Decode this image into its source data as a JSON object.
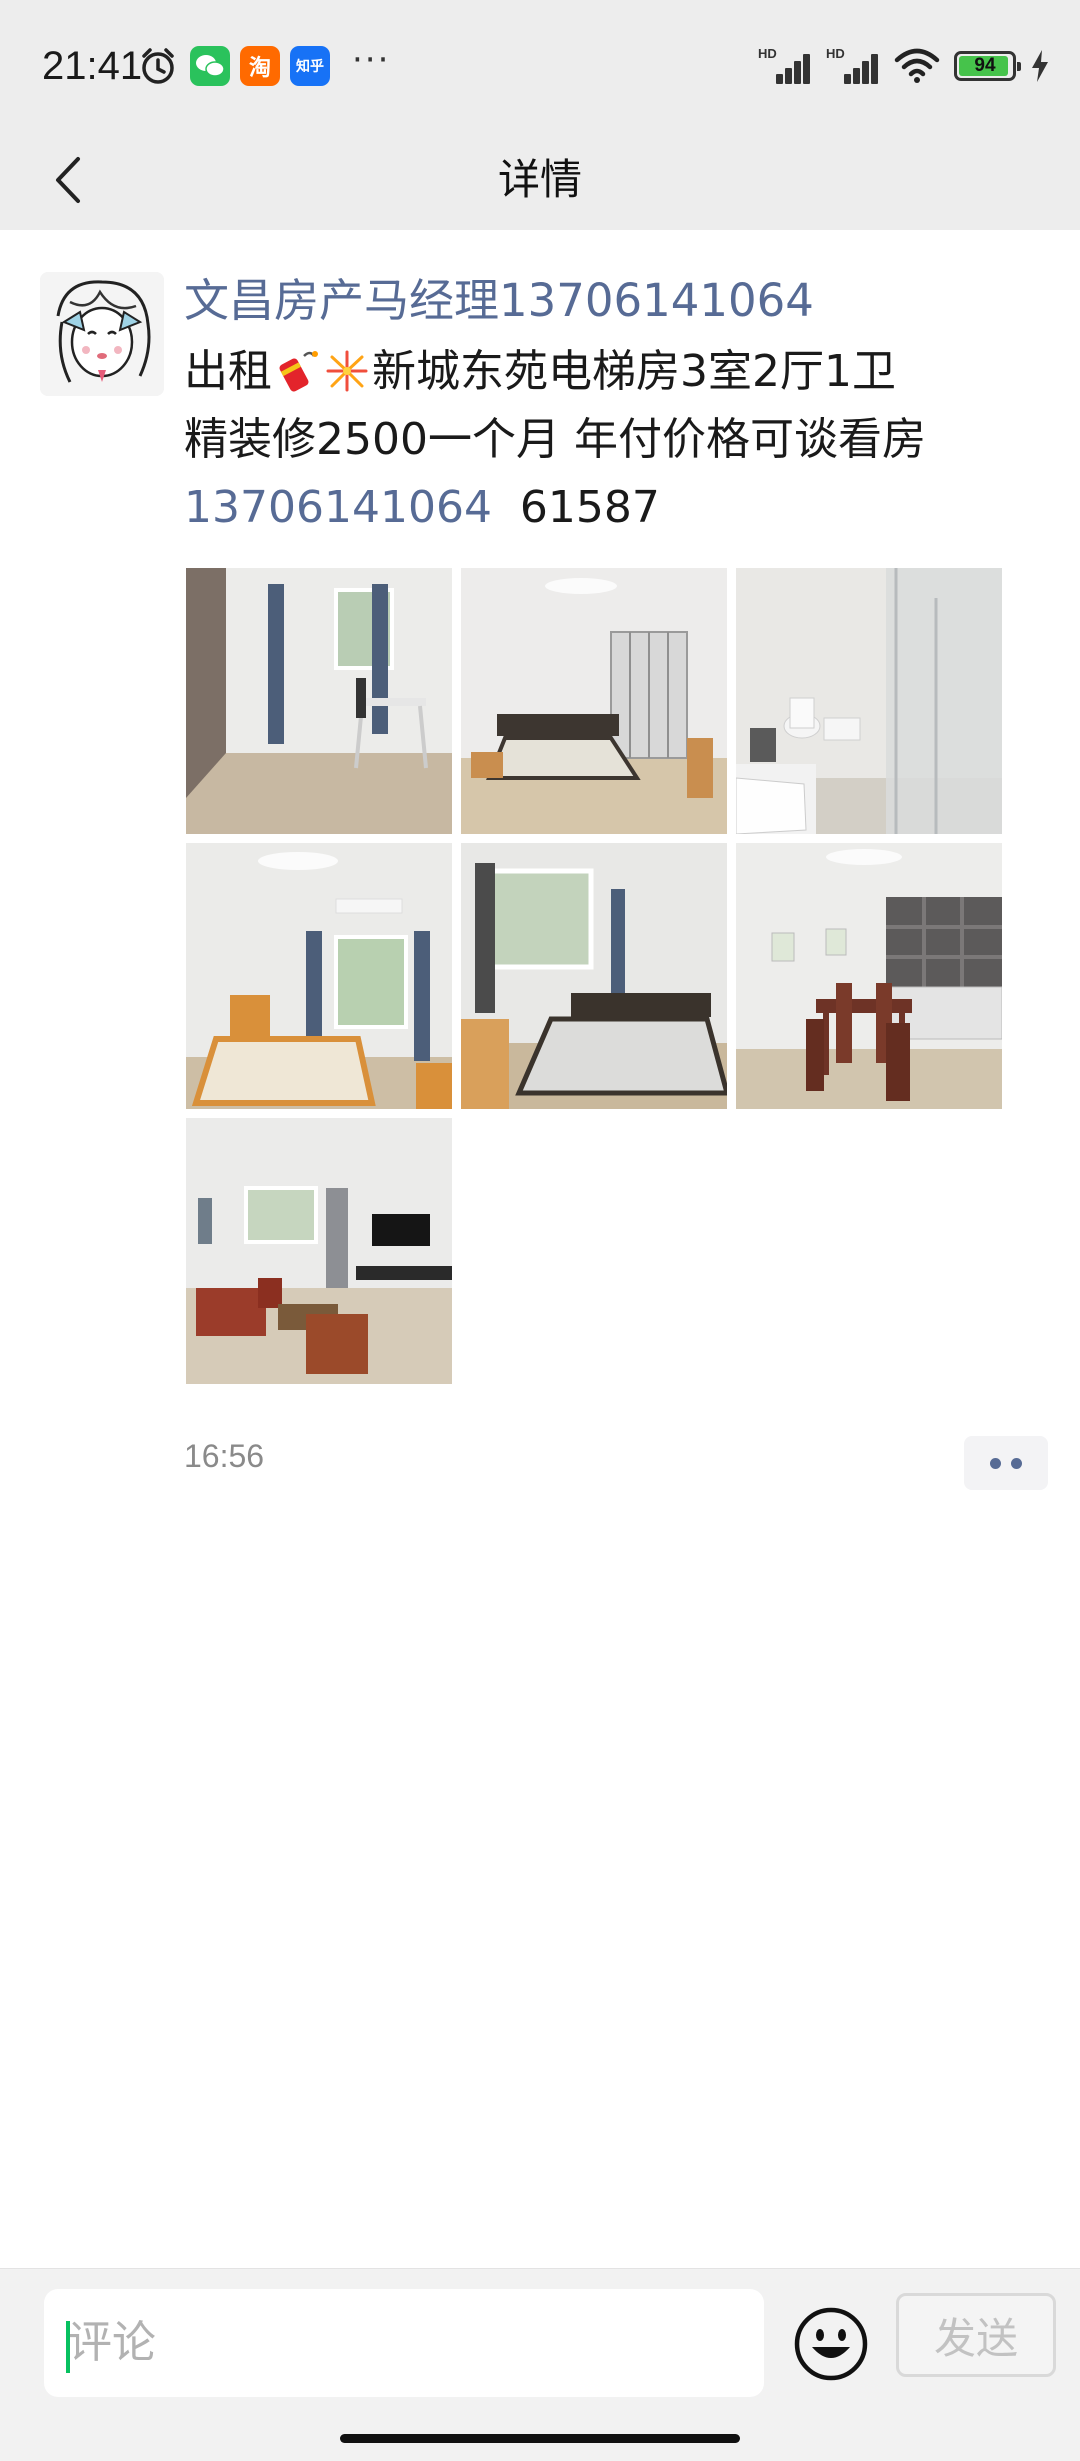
{
  "status_bar": {
    "time": "21:41",
    "battery": "94",
    "battery_level": 0.94,
    "apps": [
      {
        "name": "wechat-icon",
        "color": "#2ac25c"
      },
      {
        "name": "taobao-icon",
        "color": "#ff6a00",
        "glyph": "淘"
      },
      {
        "name": "zhihu-icon",
        "color": "#1772f6",
        "glyph": "知乎"
      }
    ],
    "signal_labels": [
      "HD",
      "HD"
    ]
  },
  "header": {
    "title": "详情",
    "back_icon": "chevron-left-icon"
  },
  "post": {
    "author": "文昌房产马经理13706141064",
    "line1_prefix": "出租",
    "line1_suffix": "新城东苑电梯房3室2厅1卫",
    "line2": "精装修2500一个月 年付价格可谈看房",
    "phone": "13706141064",
    "phone_suffix": "61587",
    "emojis": [
      "firecracker-emoji",
      "fireworks-emoji"
    ],
    "photos": [
      "living-room-window-photo",
      "bedroom-wardrobe-photo",
      "bathroom-photo",
      "bedroom-orange-bed-photo",
      "bedroom-grey-bed-photo",
      "dining-room-photo",
      "living-room-sofa-photo"
    ],
    "time": "16:56",
    "link_color": "#576b95"
  },
  "comment_bar": {
    "placeholder": "评论",
    "send_label": "发送",
    "emoji_icon": "smiley-icon"
  }
}
